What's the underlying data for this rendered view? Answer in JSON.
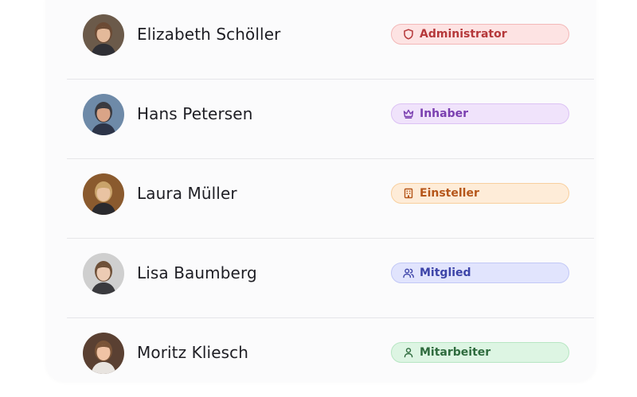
{
  "members": [
    {
      "name": "Elizabeth Schöller",
      "role": "Administrator",
      "role_icon": "shield-icon",
      "badge_colors": {
        "bg": "#fde3e3",
        "border": "#f3b8b8",
        "text": "#b5383a"
      },
      "avatar_colors": {
        "bg": "#6b5a4a",
        "skin": "#e3b99a",
        "hair": "#6b4a34",
        "shirt": "#2f2f35"
      }
    },
    {
      "name": "Hans Petersen",
      "role": "Inhaber",
      "role_icon": "crown-icon",
      "badge_colors": {
        "bg": "#f0e3fb",
        "border": "#dcc2f4",
        "text": "#7a3fb0"
      },
      "avatar_colors": {
        "bg": "#6e8aa8",
        "skin": "#d9a487",
        "hair": "#3a3a40",
        "shirt": "#2c3448"
      }
    },
    {
      "name": "Laura Müller",
      "role": "Einsteller",
      "role_icon": "building-icon",
      "badge_colors": {
        "bg": "#feecd8",
        "border": "#f8cf9e",
        "text": "#b5561a"
      },
      "avatar_colors": {
        "bg": "#8a5a2e",
        "skin": "#e9c3a2",
        "hair": "#c9a36a",
        "shirt": "#2a2a2e"
      }
    },
    {
      "name": "Lisa Baumberg",
      "role": "Mitglied",
      "role_icon": "users-icon",
      "badge_colors": {
        "bg": "#e1e4fd",
        "border": "#c2c8f6",
        "text": "#3d44a8"
      },
      "avatar_colors": {
        "bg": "#cfcfcf",
        "skin": "#eccbb4",
        "hair": "#6e5038",
        "shirt": "#3a3a3e"
      }
    },
    {
      "name": "Moritz Kliesch",
      "role": "Mitarbeiter",
      "role_icon": "user-icon",
      "badge_colors": {
        "bg": "#ddf5e3",
        "border": "#b7e6c3",
        "text": "#2f6b3e"
      },
      "avatar_colors": {
        "bg": "#5a4032",
        "skin": "#f0c3a5",
        "hair": "#7a5438",
        "shirt": "#e8e4e0"
      }
    }
  ]
}
